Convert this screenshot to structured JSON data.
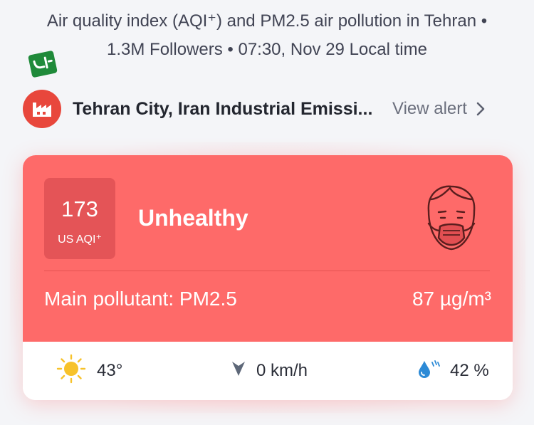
{
  "header": {
    "title_line1": "Air quality index (AQI⁺) and PM2.5 air pollution in Tehran •",
    "title_line2": "1.3M Followers • 07:30, Nov 29 Local time"
  },
  "alert": {
    "text": "Tehran City, Iran Industrial Emissi...",
    "action_label": "View alert"
  },
  "aqi": {
    "value": "173",
    "unit": "US AQI⁺",
    "level": "Unhealthy",
    "main_pollutant": "Main pollutant: PM2.5",
    "concentration": "87 µg/m³",
    "color": "#fe6a69"
  },
  "weather": {
    "temperature": "43°",
    "wind": "0 km/h",
    "humidity": "42 %"
  }
}
